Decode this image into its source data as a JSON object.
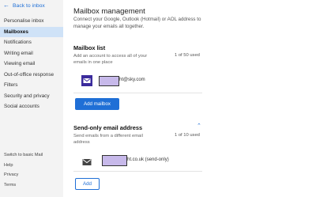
{
  "sidebar": {
    "back_label": "Back to inbox",
    "items": [
      {
        "label": "Personalise inbox"
      },
      {
        "label": "Mailboxes"
      },
      {
        "label": "Notifications"
      },
      {
        "label": "Writing email"
      },
      {
        "label": "Viewing email"
      },
      {
        "label": "Out-of-office response"
      },
      {
        "label": "Filters"
      },
      {
        "label": "Security and privacy"
      },
      {
        "label": "Social accounts"
      }
    ],
    "active": "Mailboxes",
    "footer": [
      {
        "label": "Switch to basic Mail"
      },
      {
        "label": "Help"
      },
      {
        "label": "Privacy"
      },
      {
        "label": "Terms"
      }
    ]
  },
  "main": {
    "title": "Mailbox management",
    "description": "Connect your Google, Outlook (Hotmail) or AOL address to manage your emails all together.",
    "mailbox_list": {
      "title": "Mailbox list",
      "description": "Add an account to access all of your emails in one place",
      "used": "1 of 50 used",
      "account_text": "ht@sky.com",
      "add_button": "Add mailbox"
    },
    "send_only": {
      "title": "Send-only email address",
      "description": "Send emails from a different email address",
      "used": "1 of 10 used",
      "account_text": "ht.co.uk (send-only)",
      "add_button": "Add"
    }
  },
  "colors": {
    "accent": "#1f6fd6",
    "sidebar_bg": "#f3f3f3",
    "active_bg": "#cfe2f7",
    "redaction": "#c7b9ea",
    "sky_icon": "#3b2b9c"
  }
}
